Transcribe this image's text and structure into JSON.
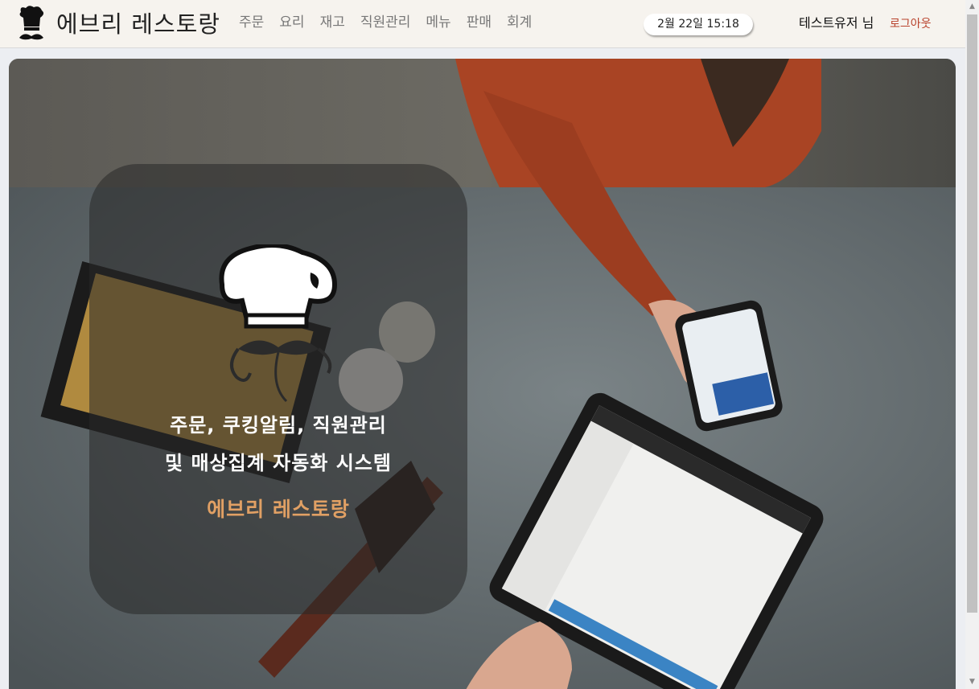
{
  "header": {
    "brand_name": "에브리 레스토랑",
    "nav": [
      "주문",
      "요리",
      "재고",
      "직원관리",
      "메뉴",
      "판매",
      "회계"
    ],
    "datetime": "2월 22일 15:18",
    "user": "테스트유저 님",
    "logout": "로그아웃"
  },
  "hero": {
    "tagline_line1": "주문, 쿠킹알림, 직원관리",
    "tagline_line2": "및 매상집계 자동화 시스템",
    "brand": "에브리 레스토랑"
  },
  "colors": {
    "header_bg": "#f6f3ee",
    "accent_orange": "#e1a064",
    "logout_red": "#b8402a"
  },
  "icons": [
    "chef-hat-logo-icon",
    "chef-hat-illustration-icon",
    "scroll-up-icon",
    "scroll-down-icon"
  ]
}
